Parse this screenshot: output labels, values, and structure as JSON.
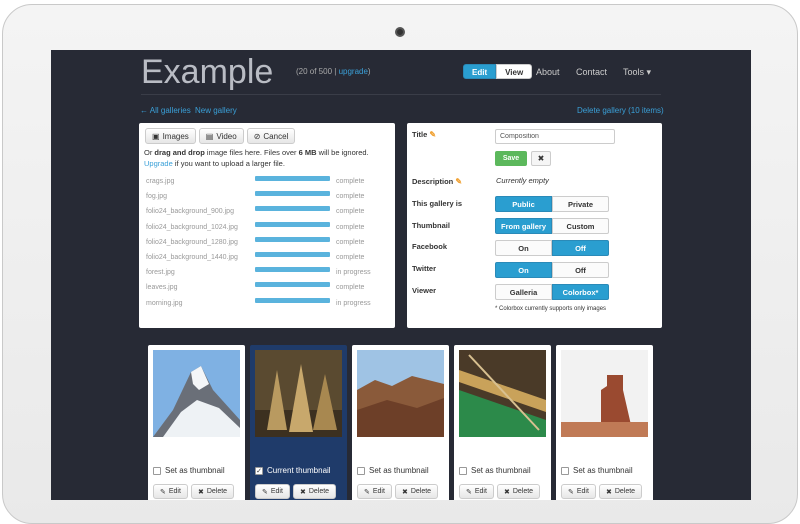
{
  "app": {
    "brand": "Example",
    "count_text": "(20 of 500 |",
    "upgrade_link": "upgrade",
    "count_close": ")"
  },
  "mode": {
    "edit": "Edit",
    "view": "View"
  },
  "nav": {
    "about": "About",
    "contact": "Contact",
    "tools": "Tools ▾"
  },
  "links": {
    "all_galleries": "← All galleries",
    "new_gallery": "New gallery",
    "delete_gallery": "Delete gallery (10 items)"
  },
  "upload": {
    "images_label": "Images",
    "video_label": "Video",
    "cancel_label": "Cancel",
    "instr_1": "Or ",
    "instr_bold_1": "drag and drop",
    "instr_2": " image files here. Files over ",
    "instr_bold_2": "6 MB",
    "instr_3": " will be ignored. ",
    "instr_upgrade": "Upgrade",
    "instr_4": " if you want to upload a larger file.",
    "files": [
      {
        "name": "crags.jpg",
        "status": "complete"
      },
      {
        "name": "fog.jpg",
        "status": "complete"
      },
      {
        "name": "folio24_background_900.jpg",
        "status": "complete"
      },
      {
        "name": "folio24_background_1024.jpg",
        "status": "complete"
      },
      {
        "name": "folio24_background_1280.jpg",
        "status": "complete"
      },
      {
        "name": "folio24_background_1440.jpg",
        "status": "complete"
      },
      {
        "name": "forest.jpg",
        "status": "in progress"
      },
      {
        "name": "leaves.jpg",
        "status": "complete"
      },
      {
        "name": "morning.jpg",
        "status": "in progress"
      }
    ]
  },
  "settings": {
    "title_label": "Title",
    "title_value": "Composition",
    "save_label": "Save",
    "cancel_glyph": "✖",
    "description_label": "Description",
    "description_value": "Currently empty",
    "gallery_is_label": "This gallery is",
    "gallery_is": {
      "a": "Public",
      "b": "Private",
      "selected": "Public"
    },
    "thumbnail_label": "Thumbnail",
    "thumbnail": {
      "a": "From gallery",
      "b": "Custom",
      "selected": "From gallery"
    },
    "facebook_label": "Facebook",
    "facebook": {
      "a": "On",
      "b": "Off",
      "selected": "Off"
    },
    "twitter_label": "Twitter",
    "twitter": {
      "a": "On",
      "b": "Off",
      "selected": "On"
    },
    "viewer_label": "Viewer",
    "viewer": {
      "a": "Galleria",
      "b": "Colorbox*",
      "selected": "Colorbox*"
    },
    "note": "* Colorbox currently supports only images"
  },
  "thumbs": [
    {
      "check_label": "Set as thumbnail",
      "checked": false,
      "edit": "Edit",
      "delete": "Delete"
    },
    {
      "check_label": "Current thumbnail",
      "checked": true,
      "edit": "Edit",
      "delete": "Delete"
    },
    {
      "check_label": "Set as thumbnail",
      "checked": false,
      "edit": "Edit",
      "delete": "Delete"
    },
    {
      "check_label": "Set as thumbnail",
      "checked": false,
      "edit": "Edit",
      "delete": "Delete"
    },
    {
      "check_label": "Set as thumbnail",
      "checked": false,
      "edit": "Edit",
      "delete": "Delete"
    }
  ],
  "colors": {
    "accent": "#2a9ed0",
    "screen_bg": "#272a35",
    "save_green": "#5cb85c",
    "current_card": "#1f3b6a"
  }
}
